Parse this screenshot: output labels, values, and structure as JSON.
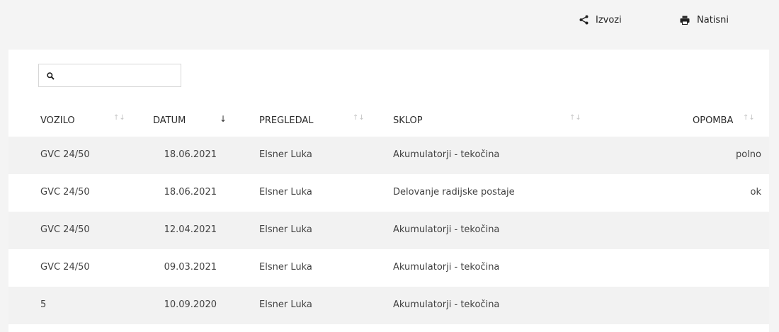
{
  "toolbar": {
    "export_label": "Izvozi",
    "print_label": "Natisni"
  },
  "search": {
    "placeholder": "",
    "value": ""
  },
  "table": {
    "columns": {
      "vozilo": "VOZILO",
      "datum": "DATUM",
      "pregledal": "PREGLEDAL",
      "sklop": "SKLOP",
      "opomba": "OPOMBA"
    },
    "sort": {
      "column": "DATUM",
      "direction": "descending"
    },
    "rows": [
      {
        "vozilo": "GVC 24/50",
        "datum": "18.06.2021",
        "pregledal": "Elsner Luka",
        "sklop": "Akumulatorji - tekočina",
        "opomba": "polno"
      },
      {
        "vozilo": "GVC 24/50",
        "datum": "18.06.2021",
        "pregledal": "Elsner Luka",
        "sklop": "Delovanje radijske postaje",
        "opomba": "ok"
      },
      {
        "vozilo": "GVC 24/50",
        "datum": "12.04.2021",
        "pregledal": "Elsner Luka",
        "sklop": "Akumulatorji - tekočina",
        "opomba": ""
      },
      {
        "vozilo": "GVC 24/50",
        "datum": "09.03.2021",
        "pregledal": "Elsner Luka",
        "sklop": "Akumulatorji - tekočina",
        "opomba": ""
      },
      {
        "vozilo": "5",
        "datum": "10.09.2020",
        "pregledal": "Elsner Luka",
        "sklop": "Akumulatorji - tekočina",
        "opomba": ""
      }
    ]
  },
  "icons": {
    "export": "share-icon",
    "print": "printer-icon",
    "search": "search-icon",
    "sort": "sort-arrows-icon"
  },
  "colors": {
    "page_background": "#f4f4f4",
    "card_background": "#ffffff",
    "row_stripe": "#f2f2f2",
    "sort_inactive": "#c4c4c4",
    "sort_active": "#333333"
  }
}
